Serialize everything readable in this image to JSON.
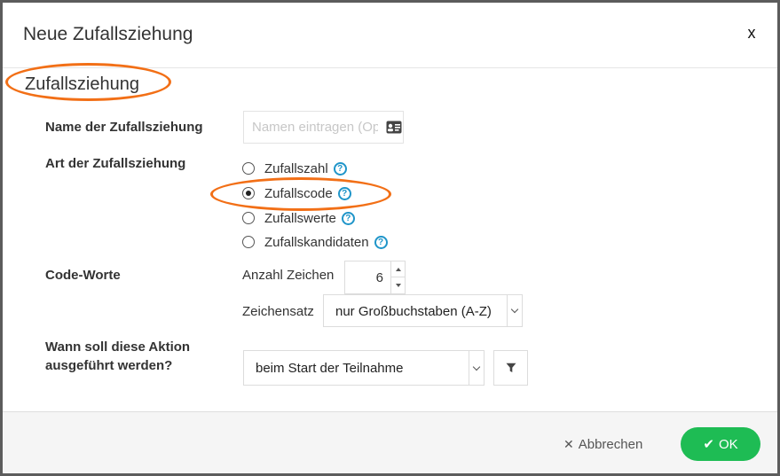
{
  "dialog": {
    "title": "Neue Zufallsziehung",
    "close_label": "x"
  },
  "section": {
    "title": "Zufallsziehung"
  },
  "name_field": {
    "label": "Name der Zufallsziehung",
    "placeholder": "Namen eintragen (Optional)",
    "value": "",
    "icon": "id-card-icon"
  },
  "draw_type": {
    "label": "Art der Zufallsziehung",
    "options": [
      {
        "label": "Zufallszahl",
        "checked": false
      },
      {
        "label": "Zufallscode",
        "checked": true
      },
      {
        "label": "Zufallswerte",
        "checked": false
      },
      {
        "label": "Zufallskandidaten",
        "checked": false
      }
    ],
    "help_glyph": "?"
  },
  "code_words": {
    "label": "Code-Worte",
    "char_count_label": "Anzahl Zeichen",
    "char_count_value": "6",
    "charset_label": "Zeichensatz",
    "charset_value": "nur Großbuchstaben (A-Z)"
  },
  "action_timing": {
    "label_line1": "Wann soll diese Aktion",
    "label_line2": "ausgeführt werden?",
    "value": "beim Start der Teilnahme",
    "filter_icon": "filter-icon"
  },
  "footer": {
    "cancel_label": "Abbrechen",
    "ok_label": "OK"
  },
  "colors": {
    "highlight": "#f26f16",
    "ok_green": "#1ebc54",
    "help_blue": "#1f95c9"
  }
}
